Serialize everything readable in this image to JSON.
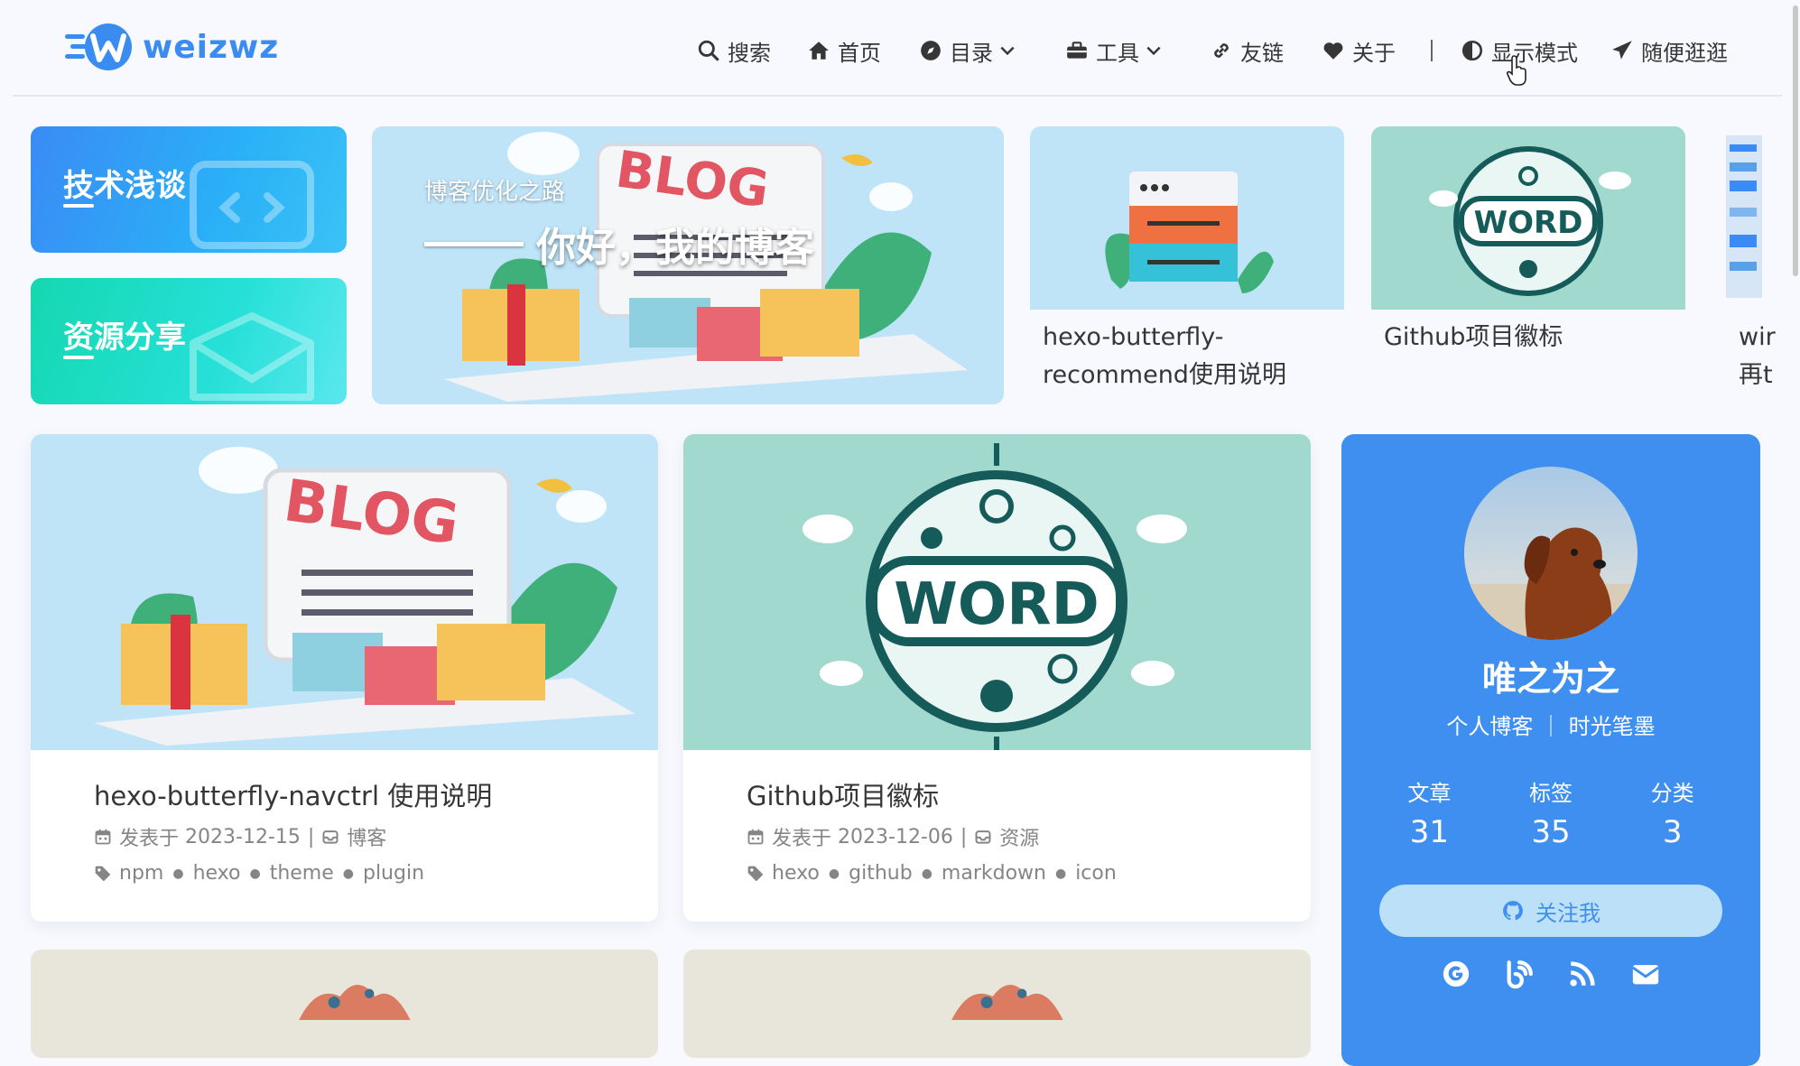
{
  "brand": {
    "name": "weizwz",
    "color": "#3b8cf0"
  },
  "nav": [
    {
      "label": "搜索",
      "icon": "search-icon"
    },
    {
      "label": "首页",
      "icon": "home-icon"
    },
    {
      "label": "目录",
      "icon": "compass-icon",
      "dropdown": true
    },
    {
      "label": "工具",
      "icon": "toolbox-icon",
      "dropdown": true
    },
    {
      "label": "友链",
      "icon": "link-icon"
    },
    {
      "label": "关于",
      "icon": "heart-icon"
    },
    {
      "label": "显示模式",
      "icon": "contrast-icon"
    },
    {
      "label": "随便逛逛",
      "icon": "paper-plane-icon"
    }
  ],
  "categories": [
    {
      "label": "技术浅谈",
      "color": "#3a8bf5"
    },
    {
      "label": "资源分享",
      "color": "#14d8b0"
    }
  ],
  "hero": {
    "kicker": "博客优化之路",
    "title": "你好，我的博客"
  },
  "mini_posts": [
    {
      "title": "hexo-butterfly-recommend使用说明"
    },
    {
      "title": "Github项目徽标"
    },
    {
      "title": "wir再t"
    }
  ],
  "posts": [
    {
      "title": "hexo-butterfly-navctrl 使用说明",
      "meta_prefix": "发表于",
      "date": "2023-12-15",
      "category": "博客",
      "tags": [
        "npm",
        "hexo",
        "theme",
        "plugin"
      ]
    },
    {
      "title": "Github项目徽标",
      "meta_prefix": "发表于",
      "date": "2023-12-06",
      "category": "资源",
      "tags": [
        "hexo",
        "github",
        "markdown",
        "icon"
      ]
    }
  ],
  "author": {
    "name": "唯之为之",
    "desc": "个人博客 ｜ 时光笔墨",
    "stats": [
      {
        "label": "文章",
        "value": "31"
      },
      {
        "label": "标签",
        "value": "35"
      },
      {
        "label": "分类",
        "value": "3"
      }
    ],
    "follow_label": "关注我",
    "socials": [
      "google-icon",
      "blog-icon",
      "rss-icon",
      "mail-icon"
    ],
    "card_color": "#3e8ff0"
  }
}
